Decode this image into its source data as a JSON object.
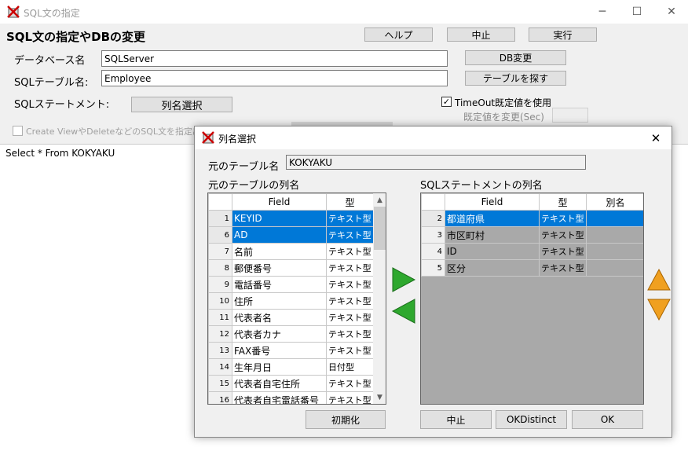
{
  "main_window": {
    "title": "SQL文の指定",
    "heading": "SQL文の指定やDBの変更",
    "buttons": {
      "help": "ヘルプ",
      "cancel": "中止",
      "run": "実行",
      "db_change": "DB変更",
      "find_table": "テーブルを探す",
      "column_select": "列名選択"
    },
    "labels": {
      "database": "データベース名",
      "sql_table": "SQLテーブル名:",
      "sql_statement": "SQLステートメント:",
      "default_change": "既定値を変更(Sec)"
    },
    "database_value": "SQLServer",
    "table_value": "Employee",
    "timeout_checkbox": {
      "label": "TimeOut既定値を使用",
      "checked": true
    },
    "create_view_checkbox": {
      "label": "Create ViewやDeleteなどのSQL文を指定出",
      "checked": false
    },
    "editor_text": "Select * From KOKYAKU"
  },
  "dialog": {
    "title": "列名選択",
    "source_table_label": "元のテーブル名",
    "source_table_value": "KOKYAKU",
    "left_grid_title": "元のテーブルの列名",
    "right_grid_title": "SQLステートメントの列名",
    "left_columns": [
      "Field",
      "型"
    ],
    "right_columns": [
      "Field",
      "型",
      "別名"
    ],
    "left_rows": [
      {
        "no": "1",
        "field": "KEYID",
        "type": "テキスト型",
        "selected": true
      },
      {
        "no": "6",
        "field": "AD",
        "type": "テキスト型",
        "selected": true
      },
      {
        "no": "7",
        "field": "名前",
        "type": "テキスト型",
        "selected": false
      },
      {
        "no": "8",
        "field": "郵便番号",
        "type": "テキスト型",
        "selected": false
      },
      {
        "no": "9",
        "field": "電話番号",
        "type": "テキスト型",
        "selected": false
      },
      {
        "no": "10",
        "field": "住所",
        "type": "テキスト型",
        "selected": false
      },
      {
        "no": "11",
        "field": "代表者名",
        "type": "テキスト型",
        "selected": false
      },
      {
        "no": "12",
        "field": "代表者カナ",
        "type": "テキスト型",
        "selected": false
      },
      {
        "no": "13",
        "field": "FAX番号",
        "type": "テキスト型",
        "selected": false
      },
      {
        "no": "14",
        "field": "生年月日",
        "type": "日付型",
        "selected": false
      },
      {
        "no": "15",
        "field": "代表者自宅住所",
        "type": "テキスト型",
        "selected": false
      },
      {
        "no": "16",
        "field": "代表者自宅電話番号",
        "type": "テキスト型",
        "selected": false
      }
    ],
    "right_rows": [
      {
        "no": "2",
        "field": "都道府県",
        "type": "テキスト型",
        "alias": "",
        "selected": true
      },
      {
        "no": "3",
        "field": "市区町村",
        "type": "テキスト型",
        "alias": "",
        "selected": false
      },
      {
        "no": "4",
        "field": "ID",
        "type": "テキスト型",
        "alias": "",
        "selected": false
      },
      {
        "no": "5",
        "field": "区分",
        "type": "テキスト型",
        "alias": "",
        "selected": false
      }
    ],
    "buttons": {
      "init": "初期化",
      "cancel": "中止",
      "ok_distinct": "OKDistinct",
      "ok": "OK"
    },
    "icons": [
      "move-right-arrow-icon",
      "move-left-arrow-icon",
      "move-up-arrow-icon",
      "move-down-arrow-icon"
    ],
    "colors": {
      "selection": "#0078d7",
      "arrow_green": "#2ea82e",
      "arrow_orange": "#f0a020",
      "empty_grid": "#a9a9a9"
    }
  }
}
